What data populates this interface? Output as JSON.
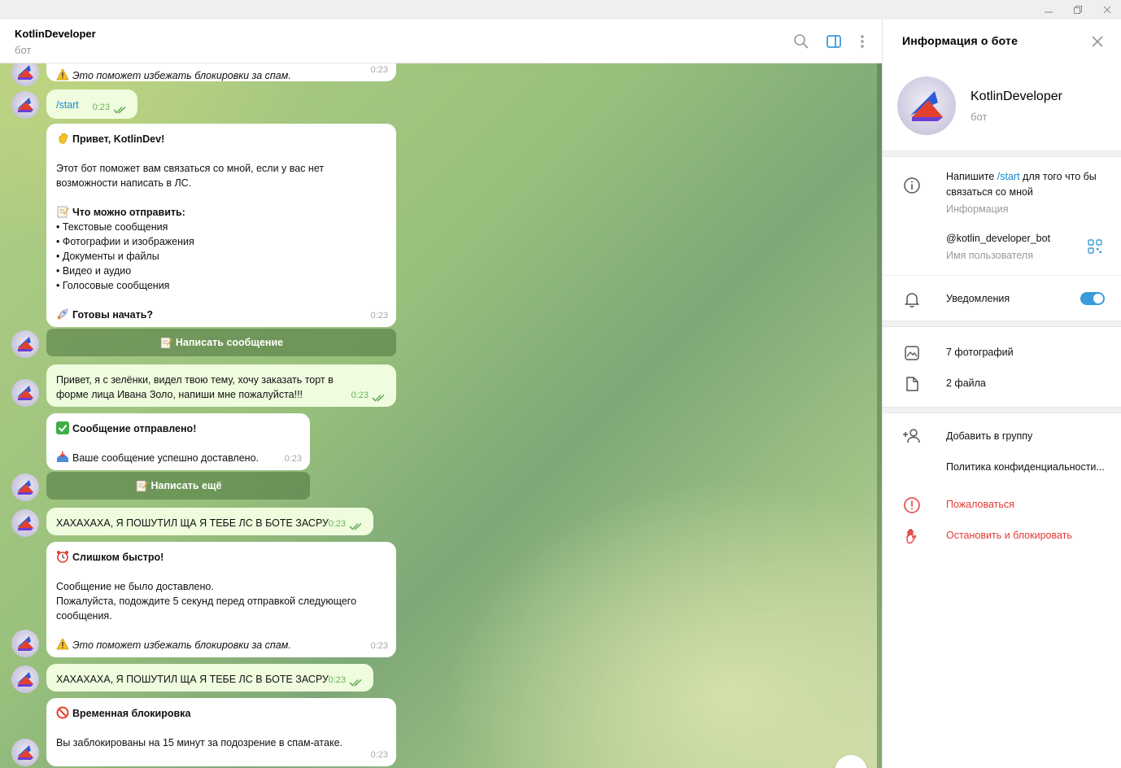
{
  "window": {
    "minimize_icon": "minimize-icon",
    "restore_icon": "restore-icon",
    "close_icon": "close-icon"
  },
  "chat_header": {
    "title": "KotlinDeveloper",
    "subtitle": "бот"
  },
  "messages": {
    "m1": {
      "warning": "Это поможет избежать блокировки за спам.",
      "time": "0:23"
    },
    "m2": {
      "text": "/start",
      "time": "0:23"
    },
    "m3": {
      "greeting": "Привет, KotlinDev!",
      "intro": "Этот бот поможет вам связаться со мной, если у вас нет возможности написать в ЛС.",
      "what_title": "Что можно отправить:",
      "items": [
        "• Текстовые сообщения",
        "• Фотографии и изображения",
        "• Документы и файлы",
        "• Видео и аудио",
        "• Голосовые сообщения"
      ],
      "ready": "Готовы начать?",
      "time": "0:23"
    },
    "kb1": {
      "label": "Написать сообщение"
    },
    "m4": {
      "text": "Привет, я с зелёнки, видел твою тему, хочу заказать торт в форме лица Ивана Золо, напиши мне пожалуйста!!!",
      "time": "0:23"
    },
    "m5": {
      "title": "Сообщение отправлено!",
      "body": "Ваше сообщение успешно доставлено.",
      "time": "0:23"
    },
    "kb2": {
      "label": "Написать ещё"
    },
    "m6": {
      "text": "ХАХАХАХА, Я ПОШУТИЛ ЩА Я ТЕБЕ ЛС В БОТЕ ЗАСРУ",
      "time": "0:23"
    },
    "m7": {
      "title": "Слишком быстро!",
      "line1": "Сообщение не было доставлено.",
      "line2": "Пожалуйста, подождите 5 секунд перед отправкой следующего сообщения.",
      "warning": "Это поможет избежать блокировки за спам.",
      "time": "0:23"
    },
    "m8": {
      "text": "ХАХАХАХА, Я ПОШУТИЛ ЩА Я ТЕБЕ ЛС В БОТЕ ЗАСРУ",
      "time": "0:23"
    },
    "m9": {
      "title": "Временная блокировка",
      "body": "Вы заблокированы на 15 минут за подозрение в спам-атаке.",
      "time": "0:23"
    }
  },
  "sidebar": {
    "title": "Информация о боте",
    "name": "KotlinDeveloper",
    "subtitle": "бот",
    "about_prefix": "Напишите ",
    "about_link": "/start",
    "about_suffix": " для того что бы связаться со мной",
    "about_hint": "Информация",
    "username": "@kotlin_developer_bot",
    "username_hint": "Имя пользователя",
    "notifications": "Уведомления",
    "notifications_on": true,
    "photos": "7 фотографий",
    "files": "2 файла",
    "add_to_group": "Добавить в группу",
    "privacy": "Политика конфиденциальности...",
    "report": "Пожаловаться",
    "block": "Остановить и блокировать"
  },
  "colors": {
    "accent": "#3a9bdc",
    "danger": "#e53935",
    "outgoing_bubble": "#effdde",
    "check": "#6bb05f"
  }
}
